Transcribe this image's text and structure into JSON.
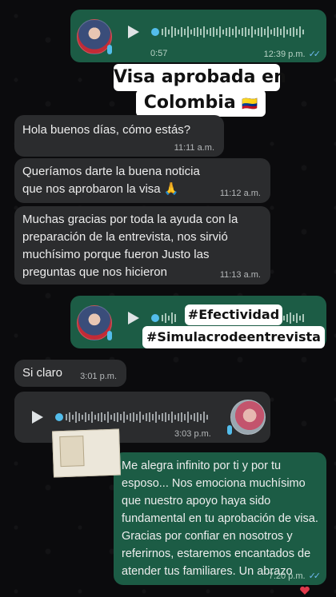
{
  "voice_out_1": {
    "duration": "0:57",
    "time": "12:39 p.m.",
    "ticks": "✓✓"
  },
  "headline": {
    "line1": "Visa aprobada en",
    "line2": "Colombia",
    "flag": "🇨🇴"
  },
  "messages_in": [
    {
      "text": "Hola buenos días, cómo estás?",
      "time": "11:11 a.m."
    },
    {
      "text": "Queríamos darte la buena noticia que nos aprobaron la visa 🙏",
      "time": "11:12 a.m."
    },
    {
      "text": "Muchas gracias por toda la ayuda con la preparación de la entrevista, nos sirvió muchísimo porque fueron Justo las preguntas que nos hicieron",
      "time": "11:13 a.m."
    }
  ],
  "voice_out_2": {
    "ticks": "✓✓"
  },
  "hashtags": [
    "#Efectividad",
    "#Simulacrodeentrevista"
  ],
  "message_in_short": {
    "text": "Si claro",
    "time": "3:01 p.m."
  },
  "voice_in": {
    "time": "3:03 p.m."
  },
  "message_out": {
    "text": "Me alegra infinito por ti y por tu esposo... Nos emociona muchísimo que nuestro apoyo haya sido fundamental en tu aprobación de visa. Gracias por confiar en nosotros y referirnos, estaremos encantados de atender tus familiares. Un abrazo",
    "time": "7:20 p.m.",
    "ticks": "✓✓"
  },
  "colors": {
    "outgoing": "#1c5c45",
    "incoming": "#2b2c2e",
    "read_ticks": "#6fb8f0",
    "mic": "#53bdeb"
  }
}
